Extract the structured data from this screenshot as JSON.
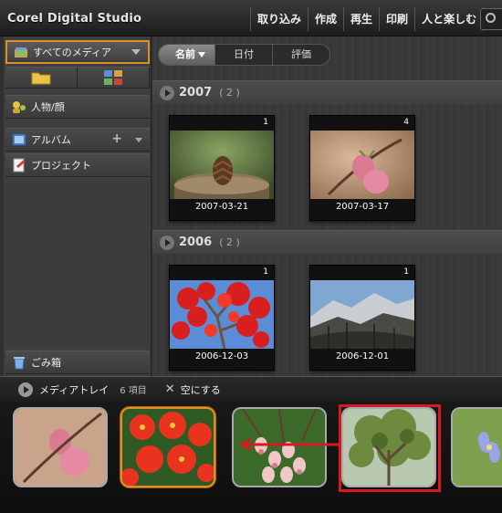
{
  "app": {
    "title": "Corel Digital Studio"
  },
  "menu": [
    {
      "label": "取り込み"
    },
    {
      "label": "作成"
    },
    {
      "label": "再生"
    },
    {
      "label": "印刷"
    },
    {
      "label": "人と楽しむ"
    }
  ],
  "sidebar": {
    "all_media": "すべてのメディア",
    "people": "人物/顔",
    "album": "アルバム",
    "project": "プロジェクト",
    "trash": "ごみ箱"
  },
  "sort": [
    {
      "label": "名前"
    },
    {
      "label": "日付"
    },
    {
      "label": "評価"
    }
  ],
  "groups": [
    {
      "year": "2007",
      "count": "( 2 )",
      "items": [
        {
          "badge": "1",
          "date": "2007-03-21",
          "subject": "pinecone-on-stump"
        },
        {
          "badge": "4",
          "date": "2007-03-17",
          "subject": "pink-bud-blossom"
        }
      ]
    },
    {
      "year": "2006",
      "count": "( 2 )",
      "items": [
        {
          "badge": "1",
          "date": "2006-12-03",
          "subject": "red-maple-leaves"
        },
        {
          "badge": "1",
          "date": "2006-12-01",
          "subject": "mountain-forest"
        }
      ]
    }
  ],
  "tray": {
    "label": "メディアトレイ",
    "count": "6 項目",
    "clear": "空にする",
    "items": [
      {
        "subject": "pink-bud-blossom"
      },
      {
        "subject": "red-dahlias",
        "selected": true
      },
      {
        "subject": "pink-bell-flowers"
      },
      {
        "subject": "green-tree-canopy",
        "highlighted": true
      },
      {
        "subject": "blue-flower"
      }
    ]
  },
  "colors": {
    "accent": "#e08e22",
    "highlight": "#d61a20"
  }
}
